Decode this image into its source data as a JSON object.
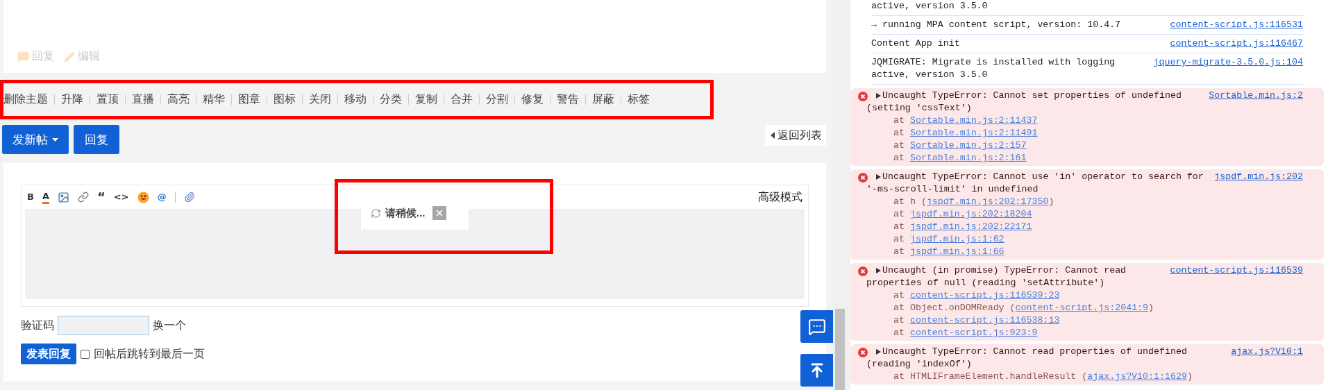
{
  "post_actions": [
    {
      "kind": "reply",
      "label": "回复"
    },
    {
      "kind": "edit",
      "label": "编辑"
    }
  ],
  "mod_actions": [
    "删除主题",
    "升降",
    "置顶",
    "直播",
    "高亮",
    "精华",
    "图章",
    "图标",
    "关闭",
    "移动",
    "分类",
    "复制",
    "合并",
    "分割",
    "修复",
    "警告",
    "屏蔽",
    "标签"
  ],
  "buttons": {
    "new_thread": "发新帖",
    "reply": "回复",
    "back": "返回列表"
  },
  "editor": {
    "tools": [
      {
        "kind": "bold",
        "text": "B"
      },
      {
        "kind": "color",
        "text": "A"
      },
      {
        "kind": "image"
      },
      {
        "kind": "link"
      },
      {
        "kind": "quote",
        "text": "“"
      },
      {
        "kind": "code",
        "text": "<>"
      },
      {
        "kind": "smiley"
      },
      {
        "kind": "at",
        "text": "@"
      },
      {
        "kind": "separator"
      },
      {
        "kind": "attach"
      }
    ],
    "mode": "高级模式"
  },
  "loading": {
    "text": "请稍候..."
  },
  "captcha": {
    "label": "验证码",
    "refresh": "换一个"
  },
  "submit": {
    "button": "发表回复",
    "checkbox": {
      "label": "回帖后跳转到最后一页",
      "checked": false
    }
  },
  "console": {
    "entries": [
      {
        "kind": "log",
        "lines": [
          "active, version 3.5.0"
        ]
      },
      {
        "kind": "log",
        "lines": [
          "→ running MPA content script, version: 10.4.7"
        ],
        "source": "content-script.js:116531"
      },
      {
        "kind": "log",
        "lines": [
          "Content App init"
        ],
        "source": "content-script.js:116467"
      },
      {
        "kind": "log",
        "lines": [
          "JQMIGRATE: Migrate is installed with logging",
          "active, version 3.5.0"
        ],
        "source": "jquery-migrate-3.5.0.js:104"
      },
      {
        "kind": "error",
        "lines": [
          "Uncaught TypeError: Cannot set properties of undefined",
          "(setting 'cssText')"
        ],
        "source": "Sortable.min.js:2",
        "stack": [
          {
            "text": "at ",
            "link": "Sortable.min.js:2:11437"
          },
          {
            "text": "at ",
            "link": "Sortable.min.js:2:11491"
          },
          {
            "text": "at ",
            "link": "Sortable.min.js:2:157"
          },
          {
            "text": "at ",
            "link": "Sortable.min.js:2:161"
          }
        ]
      },
      {
        "kind": "error",
        "lines": [
          "Uncaught TypeError: Cannot use 'in' operator to search for",
          "'-ms-scroll-limit' in undefined"
        ],
        "source": "jspdf.min.js:202",
        "stack": [
          {
            "text": "at h (",
            "link": "jspdf.min.js:202:17350",
            "after": ")"
          },
          {
            "text": "at ",
            "link": "jspdf.min.js:202:18204"
          },
          {
            "text": "at ",
            "link": "jspdf.min.js:202:22171"
          },
          {
            "text": "at ",
            "link": "jspdf.min.js:1:62"
          },
          {
            "text": "at ",
            "link": "jspdf.min.js:1:66"
          }
        ]
      },
      {
        "kind": "error",
        "lines": [
          "Uncaught (in promise) TypeError: Cannot read",
          "properties of null (reading 'setAttribute')"
        ],
        "source": "content-script.js:116539",
        "stack": [
          {
            "text": "at ",
            "link": "content-script.js:116539:23"
          },
          {
            "text": "at Object.onDOMReady (",
            "link": "content-script.js:2041:9",
            "after": ")"
          },
          {
            "text": "at ",
            "link": "content-script.js:116538:13"
          },
          {
            "text": "at ",
            "link": "content-script.js:923:9"
          }
        ]
      },
      {
        "kind": "error",
        "lines": [
          "Uncaught TypeError: Cannot read properties of undefined",
          "(reading 'indexOf')"
        ],
        "source": "ajax.js?V10:1",
        "stack": [
          {
            "text": "at HTMLIFrameElement.handleResult (",
            "link": "ajax.js?V10:1:1629",
            "after": ")"
          }
        ]
      }
    ]
  }
}
